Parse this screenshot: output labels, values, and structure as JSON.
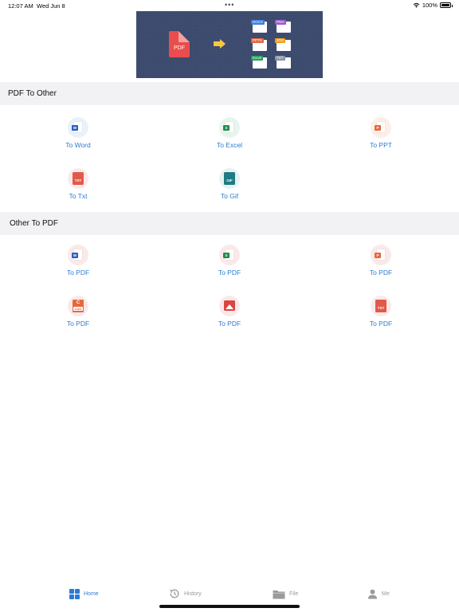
{
  "status_bar": {
    "time": "12:07 AM",
    "date": "Wed Jun 8",
    "dots": "•••",
    "battery": "100%"
  },
  "banner": {
    "source_label": "PDF",
    "targets": [
      "DOCX",
      "PNG",
      "PPTX",
      "JPG",
      "Excel",
      "TXT"
    ]
  },
  "sections": {
    "pdf_to_other": {
      "title": "PDF To Other",
      "items": [
        {
          "label": "To Word",
          "icon": "word-icon",
          "badge": "W"
        },
        {
          "label": "To Excel",
          "icon": "excel-icon",
          "badge": "X"
        },
        {
          "label": "To PPT",
          "icon": "ppt-icon",
          "badge": "P"
        },
        {
          "label": "To Txt",
          "icon": "txt-icon",
          "badge": "TXT"
        },
        {
          "label": "To Gif",
          "icon": "gif-icon",
          "badge": "GIF"
        }
      ]
    },
    "other_to_pdf": {
      "title": "Other To PDF",
      "items": [
        {
          "label": "To PDF",
          "icon": "word-icon",
          "badge": "W"
        },
        {
          "label": "To PDF",
          "icon": "excel-icon",
          "badge": "X"
        },
        {
          "label": "To PDF",
          "icon": "ppt-icon",
          "badge": "P"
        },
        {
          "label": "To PDF",
          "icon": "cad-icon",
          "badge": "CAD",
          "letter": "C"
        },
        {
          "label": "To PDF",
          "icon": "image-icon"
        },
        {
          "label": "To PDF",
          "icon": "txt-icon",
          "badge": "TXT"
        }
      ]
    }
  },
  "tab_bar": {
    "home": "Home",
    "history": "History",
    "file": "File",
    "me": "Me"
  },
  "colors": {
    "accent": "#2b7cd3",
    "section_bg": "#f2f2f4",
    "banner_bg": "#3c4a6e"
  }
}
